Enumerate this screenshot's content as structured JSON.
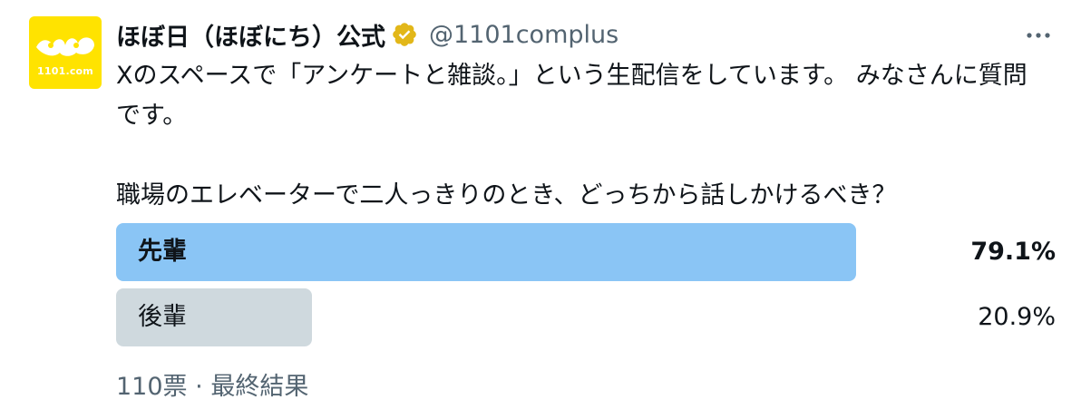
{
  "colors": {
    "accent_bar": "#8ac5f5",
    "muted_bar": "#cfd9de",
    "text_primary": "#0f1419",
    "text_secondary": "#536471",
    "avatar_bg": "#ffe300",
    "verified_badge": "#e2b719"
  },
  "author": {
    "display_name": "ほぼ日（ほぼにち）公式",
    "handle": "@1101complus",
    "avatar_text": "1101.com",
    "verified_icon": "verified-gold-badge"
  },
  "more_icon": "more-horizontal-icon",
  "tweet": {
    "paragraphs": [
      "Xのスペースで「アンケートと雑談。」という生配信をしています。 みなさんに質問です。",
      "職場のエレベーターで二人っきりのとき、どっちから話しかけるべき？"
    ]
  },
  "poll": {
    "options": [
      {
        "label": "先輩",
        "percent_text": "79.1%",
        "fraction": 0.791,
        "winner": true
      },
      {
        "label": "後輩",
        "percent_text": "20.9%",
        "fraction": 0.209,
        "winner": false
      }
    ],
    "votes": "110票",
    "separator": "·",
    "status": "最終結果"
  }
}
